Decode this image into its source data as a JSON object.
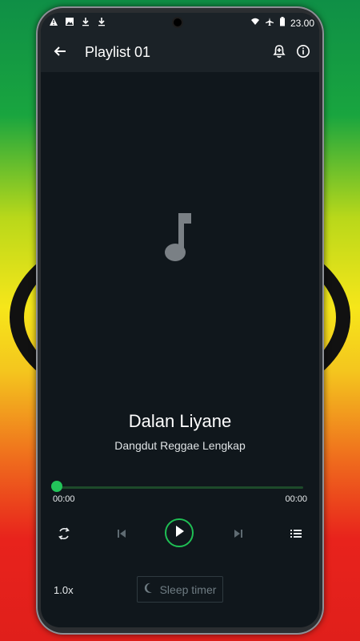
{
  "status": {
    "time": "23.00"
  },
  "appbar": {
    "title": "Playlist 01"
  },
  "track": {
    "title": "Dalan Liyane",
    "artist": "Dangdut Reggae Lengkap",
    "elapsed": "00:00",
    "duration": "00:00",
    "progress": 0
  },
  "controls": {
    "speed": "1.0x",
    "sleep_timer": "Sleep timer"
  },
  "colors": {
    "accent": "#1fbf54",
    "screen_bg": "#10171c",
    "appbar_bg": "#1b2227"
  },
  "icons": {
    "back": "arrow-left-icon",
    "add": "add-notification-icon",
    "info": "info-icon",
    "repeat": "repeat-icon",
    "previous": "previous-icon",
    "play": "play-icon",
    "next": "next-icon",
    "queue": "queue-icon",
    "sleep": "moon-icon"
  }
}
